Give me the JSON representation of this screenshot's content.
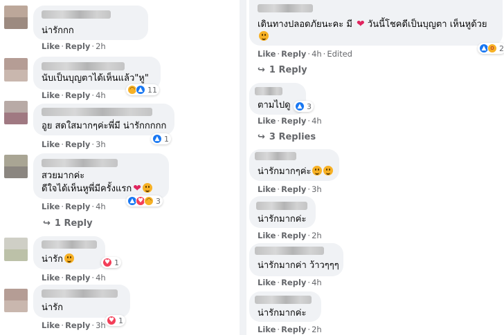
{
  "comments_left": [
    {
      "text": "น่ารักกก",
      "meta": {
        "like": "Like",
        "reply": "Reply",
        "time": "2h"
      }
    },
    {
      "text": "นับเป็นบุญตาได้เห็นแล้ว\"หู\"",
      "meta": {
        "like": "Like",
        "reply": "Reply",
        "time": "4h"
      },
      "reaction_count": "11"
    },
    {
      "text": "อูย สดใสมากๆค่ะพี่มี น่ารักกกกก",
      "meta": {
        "like": "Like",
        "reply": "Reply",
        "time": "3h"
      },
      "reaction_count": "1"
    },
    {
      "line1": "สวยมากค่ะ",
      "line2": "ดีใจได้เห็นหูพี่มีครั้งแรก",
      "meta": {
        "like": "Like",
        "reply": "Reply",
        "time": "4h"
      },
      "reaction_count": "3",
      "replies": "1 Reply"
    },
    {
      "text": "น่ารัก",
      "meta": {
        "like": "Like",
        "reply": "Reply",
        "time": "4h"
      },
      "reaction_count": "1"
    },
    {
      "text": "น่ารัก",
      "meta": {
        "like": "Like",
        "reply": "Reply",
        "time": "3h"
      },
      "reaction_count": "1"
    }
  ],
  "comments_right": [
    {
      "line1": "เดินทางปลอดภัยนะคะ มี",
      "line1b": "วันนี้โชคดีเป็นบุญตา เห็นหูด้วย",
      "meta": {
        "like": "Like",
        "reply": "Reply",
        "time": "4h",
        "edited": "Edited"
      },
      "reaction_count": "2",
      "replies": "1 Reply"
    },
    {
      "text": "ตามไปดู",
      "meta": {
        "like": "Like",
        "reply": "Reply",
        "time": "4h"
      },
      "reaction_count": "3",
      "replies": "3 Replies"
    },
    {
      "text": "น่ารักมากๆค่ะ",
      "meta": {
        "like": "Like",
        "reply": "Reply",
        "time": "3h"
      }
    },
    {
      "text": "น่ารักมากค่ะ",
      "meta": {
        "like": "Like",
        "reply": "Reply",
        "time": "2h"
      }
    },
    {
      "text": "น่ารักมากค่า ว้าวๆๆๆ",
      "meta": {
        "like": "Like",
        "reply": "Reply",
        "time": "4h"
      }
    },
    {
      "text": "น่ารักมากค่ะ",
      "meta": {
        "like": "Like",
        "reply": "Reply",
        "time": "2h"
      }
    }
  ],
  "icons": {
    "like": "like-reaction-icon",
    "haha": "haha-reaction-icon",
    "love": "love-reaction-icon",
    "care": "care-reaction-icon",
    "reply_arrow": "reply-arrow-icon"
  },
  "colors": {
    "bubble": "#f0f2f5",
    "meta": "#65676b",
    "like_blue": "#1877f2",
    "love_red": "#f33e58"
  },
  "glyphs": {
    "arrow": "↪",
    "heart": "❤",
    "thumb": "👍",
    "laugh": "😆",
    "love": "❤",
    "care": "🥰"
  }
}
